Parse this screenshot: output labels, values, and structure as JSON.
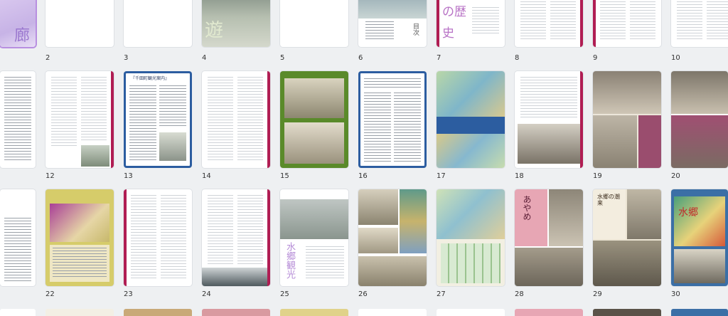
{
  "pages": {
    "row1": [
      {
        "num": "",
        "cover_text": "廊"
      },
      {
        "num": "2"
      },
      {
        "num": "3"
      },
      {
        "num": "4",
        "cover_text": "遊"
      },
      {
        "num": "5"
      },
      {
        "num": "6",
        "cover_text": "目次"
      },
      {
        "num": "7",
        "cover_text": "の歴史"
      },
      {
        "num": "8"
      },
      {
        "num": "9"
      },
      {
        "num": "10"
      }
    ],
    "row2": [
      {
        "num": "12"
      },
      {
        "num": "13",
        "heading": "『千田町観光案内』"
      },
      {
        "num": "14"
      },
      {
        "num": "15"
      },
      {
        "num": "16"
      },
      {
        "num": "17"
      },
      {
        "num": "18"
      },
      {
        "num": "19"
      },
      {
        "num": "20"
      }
    ],
    "row3": [
      {
        "num": "22"
      },
      {
        "num": "23"
      },
      {
        "num": "24"
      },
      {
        "num": "25",
        "cover_text": "水郷観光"
      },
      {
        "num": "26"
      },
      {
        "num": "27"
      },
      {
        "num": "28",
        "cover_text": "あやめ"
      },
      {
        "num": "29",
        "cover_text": "水郷の潮来"
      },
      {
        "num": "30",
        "cover_text": "水郷"
      }
    ]
  },
  "colors": {
    "selection": "#b88fe0",
    "accent_magenta": "#b01d53",
    "accent_blue": "#2c5da0",
    "accent_green": "#5a8a2a",
    "heading_purple": "#6a3fb0"
  }
}
